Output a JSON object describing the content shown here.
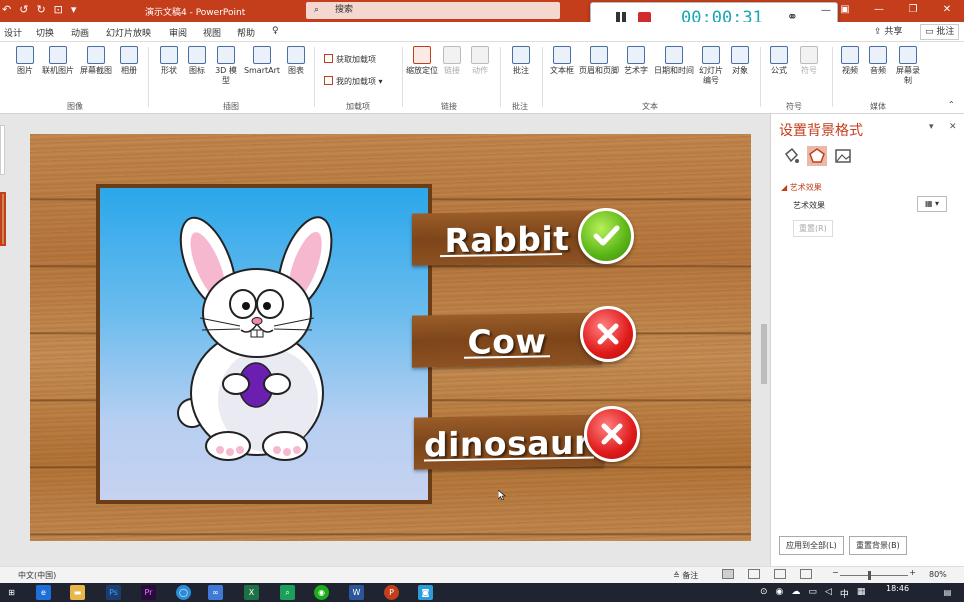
{
  "title_bar": {
    "document_title": "演示文稿4  -  PowerPoint",
    "search_placeholder": "搜索"
  },
  "recorder": {
    "time": "00:00:31"
  },
  "ribbon_tabs": [
    "设计",
    "切换",
    "动画",
    "幻灯片放映",
    "审阅",
    "视图",
    "帮助"
  ],
  "share_label": "共享",
  "comment_label": "批注",
  "ribbon": {
    "images": {
      "picture": "图片",
      "online_picture": "联机图片",
      "screenshot": "屏幕截图",
      "album": "相册",
      "group": "图像"
    },
    "illustrations": {
      "shapes": "形状",
      "icons": "图标",
      "model3d": "3D 模型",
      "smartart": "SmartArt",
      "chart": "图表",
      "group": "插图"
    },
    "addins": {
      "get": "获取加载项",
      "mine": "我的加载项",
      "group": "加载项"
    },
    "links": {
      "zoom": "缩放定位",
      "link": "链接",
      "action": "动作",
      "group": "链接"
    },
    "comments": {
      "comment": "批注",
      "group": "批注"
    },
    "text": {
      "textbox": "文本框",
      "header_footer": "页眉和页脚",
      "wordart": "艺术字",
      "datetime": "日期和时间",
      "slide_number": "幻灯片编号",
      "object": "对象",
      "group": "文本"
    },
    "symbols": {
      "equation": "公式",
      "symbol": "符号",
      "group": "符号"
    },
    "media": {
      "video": "视频",
      "audio": "音频",
      "screen_recording": "屏幕录制",
      "group": "媒体"
    }
  },
  "slide": {
    "words": [
      {
        "text": "Rabbit",
        "result": "correct"
      },
      {
        "text": "Cow",
        "result": "wrong"
      },
      {
        "text": "dinosaur",
        "result": "wrong"
      }
    ]
  },
  "format_pane": {
    "title": "设置背景格式",
    "section": "艺术效果",
    "field_label": "艺术效果",
    "reset": "重置(R)",
    "apply_all": "应用到全部(L)",
    "reset_background": "重置背景(B)"
  },
  "status_bar": {
    "language": "中文(中国)",
    "notes": "备注",
    "zoom": "80%"
  },
  "taskbar": {
    "ime": "中",
    "time": "18:46"
  },
  "colors": {
    "accent": "#c43e1c",
    "timer": "#1aa7b5",
    "correct": "#5ab516",
    "wrong": "#e01a1a"
  }
}
